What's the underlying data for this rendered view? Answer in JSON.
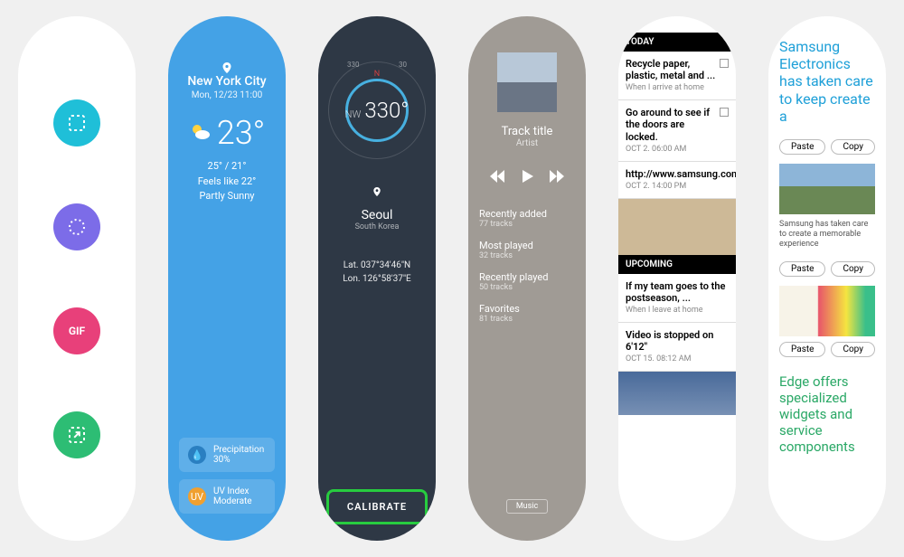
{
  "weather": {
    "city": "New York City",
    "datetime": "Mon, 12/23 11:00",
    "temp": "23°",
    "hi_lo": "25° / 21°",
    "feels": "Feels like 22°",
    "cond": "Partly Sunny",
    "precip_label": "Precipitation",
    "precip_val": "30%",
    "uv_label": "UV Index",
    "uv_val": "Moderate"
  },
  "compass": {
    "direction": "NW",
    "degrees": "330°",
    "city": "Seoul",
    "country": "South Korea",
    "lat": "Lat. 037°34'46\"N",
    "lon": "Lon. 126°58'37\"E",
    "calibrate": "CALIBRATE",
    "tick330": "330",
    "tick30": "30"
  },
  "music": {
    "title": "Track title",
    "artist": "Artist",
    "lists": {
      "recent_added": "Recently added",
      "recent_added_n": "77 tracks",
      "most": "Most played",
      "most_n": "32 tracks",
      "recent_played": "Recently played",
      "recent_played_n": "50 tracks",
      "fav": "Favorites",
      "fav_n": "81 tracks"
    },
    "chip": "Music"
  },
  "tasks": {
    "today": "TODAY",
    "upcoming": "UPCOMING",
    "t1": "Recycle paper, plastic, metal and ...",
    "t1s": "When I arrive at home",
    "t2": "Go around to see if the doors are locked.",
    "t2s": "OCT 2. 06:00 AM",
    "t3": "http://www.samsung.com",
    "t3s": "OCT 2. 14:00 PM",
    "t4": "If my team goes to the postseason, ...",
    "t4s": "When I leave at home",
    "t5": "Video is stopped on 6'12\"",
    "t5s": "OCT 15. 08:12 AM"
  },
  "clip": {
    "title": "Samsung Electronics has taken care to keep create a",
    "body1": "Samsung has taken care to create a memorable experience",
    "green": "Edge offers specialized widgets and service components",
    "paste": "Paste",
    "copy": "Copy"
  }
}
